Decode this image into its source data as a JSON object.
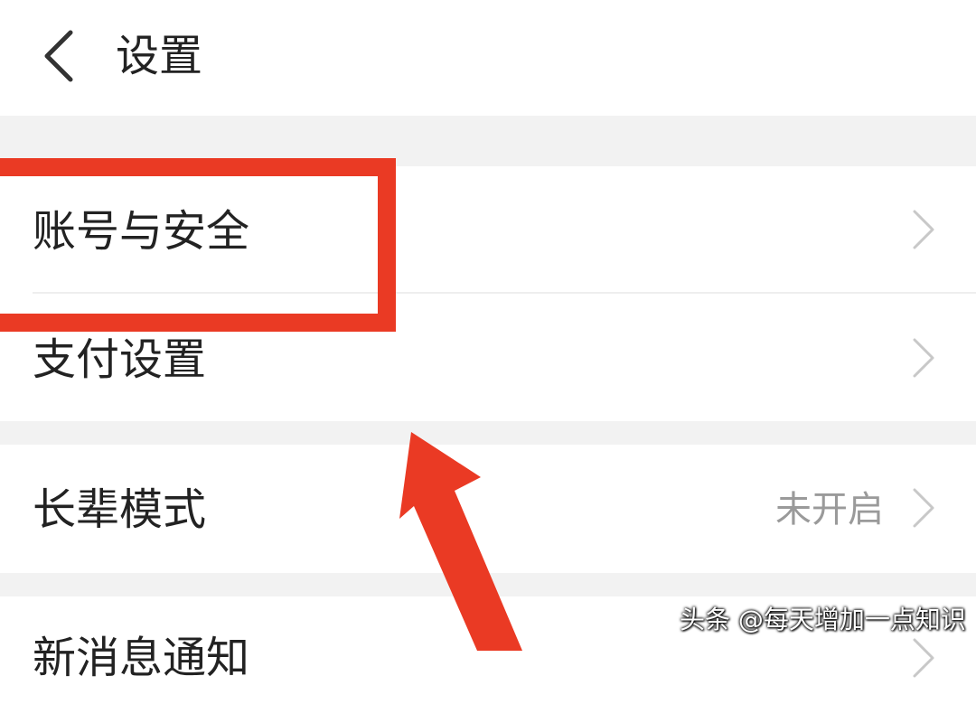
{
  "header": {
    "title": "设置",
    "back_icon": "chevron-left-icon"
  },
  "settings": {
    "items": [
      {
        "label": "账号与安全",
        "value": "",
        "icon": "chevron-right-icon"
      },
      {
        "label": "支付设置",
        "value": "",
        "icon": "chevron-right-icon"
      },
      {
        "label": "长辈模式",
        "value": "未开启",
        "icon": "chevron-right-icon"
      },
      {
        "label": "新消息通知",
        "value": "",
        "icon": "chevron-right-icon"
      }
    ]
  },
  "annotation": {
    "highlight_color": "#ea3a24",
    "watermark": "头条 @每天增加一点知识"
  },
  "colors": {
    "background": "#ffffff",
    "section_gap": "#f2f2f2",
    "text_primary": "#222222",
    "text_secondary": "#9a9a9a",
    "chevron": "#c8c8c8"
  }
}
